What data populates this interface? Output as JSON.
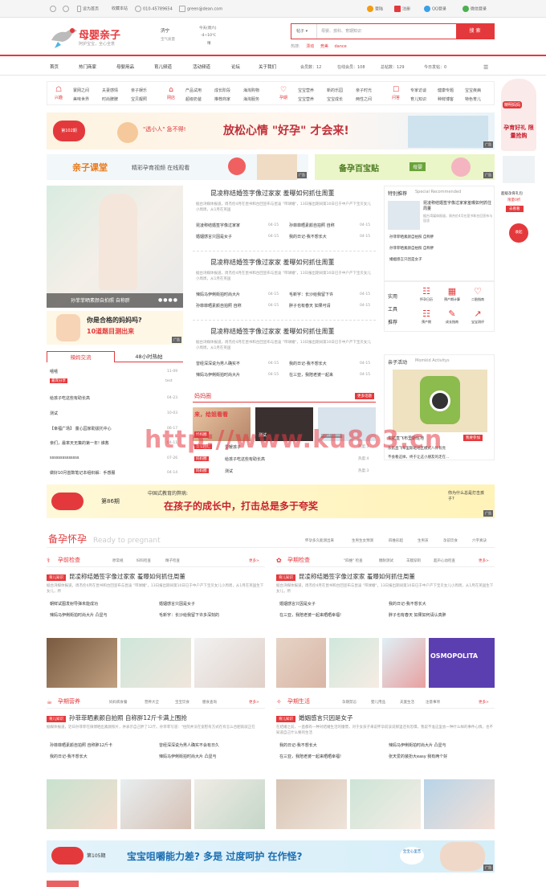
{
  "topbar": {
    "set_home": "设为首页",
    "bookmark": "收藏本站",
    "phone": "010-45789654",
    "email": "green@dean.com",
    "login": "登陆",
    "register": "注册",
    "qq_login": "QQ登录",
    "wechat_login": "微信登录"
  },
  "logo": {
    "brand": "母婴亲子",
    "slogan": "阿护宝宝，全心全意"
  },
  "weather": {
    "city": "济宁",
    "label": "宝气质量",
    "today": "今天(周六)",
    "temp": "-4~10℃",
    "cond": "晴"
  },
  "search": {
    "type": "帖子",
    "placeholder": "母婴、孩科、育期知识",
    "button": "搜 索",
    "hot_label": "热搜:",
    "hot": [
      "漂动",
      "竞美",
      "dance"
    ]
  },
  "nav": {
    "items": [
      "首页",
      "热门商家",
      "母婴用品",
      "育儿频道",
      "活动频道",
      "论坛",
      "关于我们"
    ],
    "members": "会员数：12",
    "online": "在线会员：108",
    "posts": "总帖数：129",
    "today": "今日发帖：0"
  },
  "categories": [
    {
      "icon": "☖",
      "name": "兴趣",
      "links": [
        "寰网之间",
        "夫妻感情",
        "亲子娱乐",
        "美味世界",
        "时尚脾脾",
        "宝贝靓照"
      ]
    },
    {
      "icon": "⌂",
      "name": "网店",
      "links": [
        "产品试用",
        "成长阶段",
        "海淘购物",
        "超级奶爸",
        "推荐商家",
        "海淘服务"
      ]
    },
    {
      "icon": "♡",
      "name": "孕期",
      "links": [
        "宝宝营养",
        "新的乐园",
        "亲子时光",
        "宝宝营养",
        "宝宝成长",
        "两性之间"
      ]
    },
    {
      "icon": "☐",
      "name": "问答",
      "links": [
        "专家访谈",
        "健康专题",
        "宝宝疾病",
        "育儿知识",
        "种鲜博客",
        "特色育儿"
      ]
    }
  ],
  "banner1": {
    "badge": "第102期",
    "left_text": "\"透小人\" 急不得!",
    "main": "放松心情 \"好孕\" 才会来!",
    "ad": "广告"
  },
  "banner2a": {
    "title": "亲子课堂",
    "text": "精彩孕育视频 在线观看",
    "ad": "广告"
  },
  "banner2b": {
    "title": "备孕百宝贴",
    "tag": "母婴",
    "ad": "广告"
  },
  "side_float": {
    "title": "精明妈妈",
    "slogan": "孕育好礼 限量抢购",
    "product": "超级孕育礼包",
    "price": "限量0折",
    "button": "去看看",
    "circle": "收起"
  },
  "focus": {
    "caption": "孙菲菲晒素颜自拍照 自称胖",
    "question": "你是合格的妈妈吗?",
    "question2": "10道题目测出来",
    "ad": "广告"
  },
  "tabs": {
    "t1": "辣妈交流",
    "t2": "48小时热帖"
  },
  "forum_list": [
    {
      "title": "嘻嘻",
      "date": "11-09"
    },
    {
      "title": "嘻嘻传情",
      "date": "test",
      "badge": "嘉宾分享"
    },
    {
      "title": "给孩子吃这些有助长高",
      "date": "04-23"
    },
    {
      "title": "测试",
      "date": "10-03"
    },
    {
      "title": "【幸福广场】 童心园家助拔托中心",
      "date": "06-17"
    },
    {
      "title": "亲们，最率天无策的第一年! 谁救",
      "date": "04-11"
    },
    {
      "title": "ssssssssssssss",
      "date": "07-26"
    },
    {
      "title": "做好10月首数笔记本组织解：手感服",
      "date": "04-14"
    }
  ],
  "news": [
    {
      "title": "昆凌称结婚签字像过家家 羞曝如何抓住周董",
      "summary": "据台湾媒体报道，周杰伦4月在昆书和台回宣布与昆凌 \"带球婚\"，13日报出期间第10日已于中户产下宝贝女儿小周周，从1月在英国",
      "items": [
        [
          "昆凌称结婚签字像过家家",
          "04-15"
        ],
        [
          "孙菲菲晒素颜自拍照 自称",
          "04-15"
        ],
        [
          "婚姻感言只因是女子",
          "04-15"
        ],
        [
          "我的日记-我不想长大",
          "04-15"
        ]
      ]
    },
    {
      "title": "昆凌称结婚签字像过家家 羞曝如何抓住周董",
      "summary": "据台湾媒体报道，周杰伦4月在昆书和台回宣布与昆凌 \"带球婚\"，13日报出期间第10日已于中户产下宝贝女儿小周周，从1月在英国",
      "items": [
        [
          "辣妈马伊俐街拍时尚大片",
          "04-15"
        ],
        [
          "毛新宇：长沙给我留下许",
          "04-15"
        ],
        [
          "孙菲菲晒素颜自拍照 自称",
          "04-15"
        ],
        [
          "胖子也有春天 如果可请",
          "04-15"
        ]
      ]
    },
    {
      "title": "昆凌称结婚签字像过家家 羞曝如何抓住周董",
      "summary": "据台湾媒体报道，周杰伦4月在昆书和台回宣布与昆凌 \"带球婚\"，13日报出期间第10日已于中户产下宝贝女儿小周周，从1月在英国",
      "items": [
        [
          "曾经深深说为男人确实不",
          "04-15"
        ],
        [
          "我的日记-我不想长大",
          "04-15"
        ],
        [
          "辣妈马伊俐街拍时尚大片",
          "04-15"
        ],
        [
          "在三亚，我陪老婆一起来",
          "04-15"
        ]
      ]
    }
  ],
  "mama_circle": {
    "title": "妈妈圈",
    "more": "更多话题",
    "pic_text": "来，给姐看看",
    "tag1": "妈妈圈",
    "tag2": "童年回忆",
    "items": [
      [
        "爱暖孩子",
        "热度:3"
      ],
      [
        "给孩子吃这些有助长高",
        "热度:4"
      ],
      [
        "测试",
        "热度:3"
      ]
    ],
    "pic2": "测试",
    "pic3": "sssssssssss"
  },
  "special": {
    "title": "特别推荐",
    "en": "Special Recommended",
    "lead": "昆凌称结婚签字像过家家羞曝如何抓住周董",
    "summary": "据台湾媒体报道，周杰伦4月在昆书和台回宣布与昆凌",
    "items": [
      "孙菲菲晒素颜自拍照 自称胖",
      "孙菲菲晒素颜自拍照 自称胖",
      "婚姻感言只因是女子"
    ]
  },
  "tools": {
    "label1": "实用",
    "label2": "工具",
    "label3": "推荐",
    "items": [
      "怀孕日历",
      "预产期计算",
      "二胎指南",
      "预产期",
      "成长指南",
      "宝宝测评"
    ]
  },
  "activity": {
    "title": "亲子活动",
    "en": "Momkid Activitys",
    "caption": "东航直飞布里斯班地",
    "join": "我要参加",
    "items": [
      "东航直飞布里斯班地区模式八体有亮",
      "不会看这样，终于让这小朋友的走在..."
    ]
  },
  "banner3": {
    "badge": "第86期",
    "top": "中国式教育的弊病:",
    "main": "在孩子的成长中，打击总是多于夸奖",
    "side": "你为什么总是打击孩子?",
    "ad": "广告"
  },
  "pregnant": {
    "title": "备孕怀孕",
    "en": "Ready to pregnant",
    "links": [
      "怀孕多久能测出来",
      "生男生女预测",
      "四维彩超",
      "生男孩",
      "孕前饮食",
      "六字真诀"
    ]
  },
  "blocks": [
    {
      "title": "孕前检查",
      "tabs": [
        "孕前检查",
        "原常规",
        "妇科检查",
        "精子检查"
      ],
      "more": "更多>",
      "tag": "育儿知识",
      "headline": "昆凌称结婚签字像过家家 羞曝如何抓住周董",
      "summary": "据台湾媒体报道，周杰伦4月在昆书和台回宣布与昆凌 \"带球婚\"，13日报出期间第10日已于中户产下宝贝女儿小周周，从1月在英国生下女儿，所",
      "items": [
        "朝鲜试图发射导弹未能成功",
        "婚姻感言只因是女子",
        "辣妈马伊俐街拍时尚大片 凸显与",
        "毛新宇：长沙给我留下许多深刻的"
      ]
    },
    {
      "title": "孕期检查",
      "tabs": [
        "孕期检查",
        "\"四维\" 检查",
        "糖耐测试",
        "羊膜穿刺",
        "超声心动检查"
      ],
      "more": "更多>",
      "tag": "育儿知识",
      "headline": "昆凌称结婚签字像过家家 羞曝如何抓住周董",
      "summary": "据台湾媒体报道，周杰伦4月在昆书和台回宣布与昆凌 \"带球婚\"，13日报出期间第10日已于中户产下宝贝女儿小周周，从1月在英国生下女儿，所",
      "items": [
        "婚姻感言只因是女子",
        "我的日记-我不想长大",
        "在三亚，我陪老婆一起来晒晒幸福!",
        "胖子也有春天 如果如何请认真胖"
      ]
    },
    {
      "title": "孕期营养",
      "tabs": [
        "孕期营养",
        "妈妈病食餐",
        "营养大全",
        "宝宝饮食",
        "膳食查询"
      ],
      "more": "更多>",
      "tag": "育儿知识",
      "headline": "孙菲菲晒素颜自拍照 自称胖12斤卡满上围抢",
      "summary": "据媒体报道，近日孙菲菲在微博晒出素颜照片，并表示自己胖了12斤。孙菲菲写道：\"住院并没在宽慰有方式在有怎么合肥就就正在",
      "items": [
        "孙菲菲晒素颜自拍照 自称胖12斤卡",
        "曾经深深说为男人确实不会有日久",
        "我的日记-我不想长大",
        "辣妈马伊俐街拍时尚大片 凸显与"
      ]
    },
    {
      "title": "孕期生活",
      "tabs": [
        "孕期生活",
        "孕期禁忌",
        "婴儿用品",
        "夫妻生活",
        "注意事项"
      ],
      "more": "更多>",
      "tag": "育儿知识",
      "headline": "婚姻感言只因是女子",
      "summary": "在结婚之前，一直都有一种对结婚生活的憧憬，对于女孩子来说怀孕前该说那里还有恐惧，我说不准这里会一种什么样的事件心情，也不知道自己什么要的生活",
      "items": [
        "我的日记-我不想长大",
        "辣妈马伊俐街拍时尚大片 凸显与",
        "在三亚，我陪老婆一起来晒晒幸福!",
        "张天爱的装扮大easy 我有两个好"
      ]
    }
  ],
  "photo_tags": [
    "Tiffani Ricco",
    "OSMOPOLITA"
  ],
  "banner4": {
    "badge": "第105期",
    "main": "宝宝咀嚼能力差? 多是 过度呵护 在作怪?",
    "side": "宝宝心里苦",
    "ad": "广告"
  },
  "watermark": "http://www.ku8o3.cn"
}
